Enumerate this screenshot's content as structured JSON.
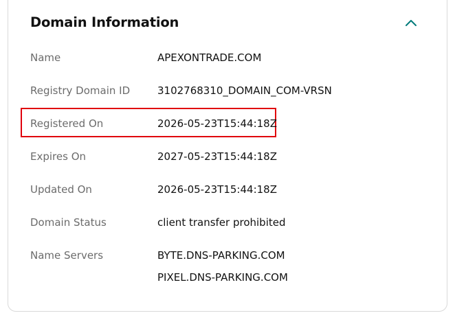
{
  "section": {
    "title": "Domain Information",
    "collapse_icon": "chevron-up-icon",
    "accent_color": "#007a7a",
    "highlight_color": "#e0000b"
  },
  "fields": [
    {
      "label": "Name",
      "value": "APEXONTRADE.COM"
    },
    {
      "label": "Registry Domain ID",
      "value": "3102768310_DOMAIN_COM-VRSN"
    },
    {
      "label": "Registered On",
      "value": "2026-05-23T15:44:18Z"
    },
    {
      "label": "Expires On",
      "value": "2027-05-23T15:44:18Z"
    },
    {
      "label": "Updated On",
      "value": "2026-05-23T15:44:18Z"
    },
    {
      "label": "Domain Status",
      "value": "client transfer prohibited"
    },
    {
      "label": "Name Servers",
      "values": [
        "BYTE.DNS-PARKING.COM",
        "PIXEL.DNS-PARKING.COM"
      ]
    }
  ]
}
